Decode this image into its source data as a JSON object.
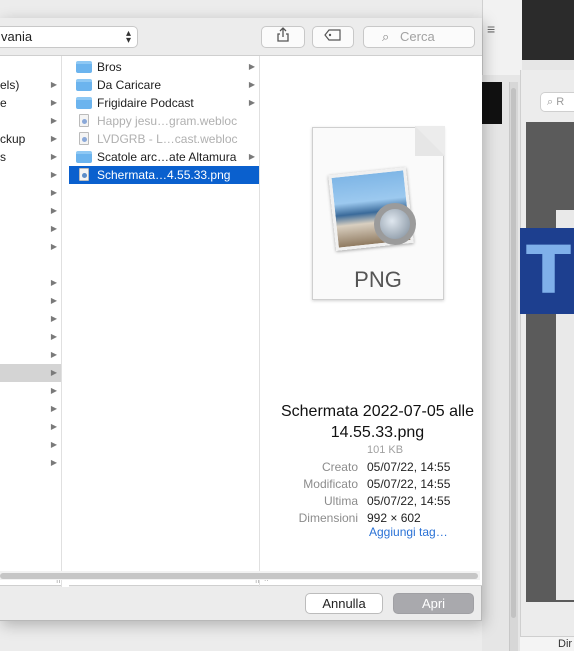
{
  "toolbar": {
    "path_value": "vania",
    "search_placeholder": "Cerca"
  },
  "sidebar_column": {
    "items": [
      {
        "label": "els)",
        "has_arrow": true,
        "selected": false
      },
      {
        "label": "e",
        "has_arrow": true,
        "selected": false
      },
      {
        "label": "",
        "has_arrow": true,
        "selected": false
      },
      {
        "label": "ckup",
        "has_arrow": true,
        "selected": false
      },
      {
        "label": "s",
        "has_arrow": true,
        "selected": false
      },
      {
        "label": "",
        "has_arrow": true,
        "selected": false
      },
      {
        "label": "",
        "has_arrow": true,
        "selected": false
      },
      {
        "label": "",
        "has_arrow": true,
        "selected": false
      },
      {
        "label": "",
        "has_arrow": true,
        "selected": false
      },
      {
        "label": "",
        "has_arrow": true,
        "selected": false
      },
      {
        "label": "",
        "has_arrow": true,
        "selected": false
      },
      {
        "label": "",
        "has_arrow": true,
        "selected": false
      },
      {
        "label": "",
        "has_arrow": true,
        "selected": false
      },
      {
        "label": "",
        "has_arrow": true,
        "selected": false
      },
      {
        "label": "",
        "has_arrow": true,
        "selected": false
      },
      {
        "label": "",
        "has_arrow": true,
        "selected": true
      },
      {
        "label": "",
        "has_arrow": true,
        "selected": false
      },
      {
        "label": "",
        "has_arrow": true,
        "selected": false
      },
      {
        "label": "",
        "has_arrow": true,
        "selected": false
      },
      {
        "label": "",
        "has_arrow": true,
        "selected": false
      },
      {
        "label": "",
        "has_arrow": true,
        "selected": false
      }
    ]
  },
  "files_column": {
    "items": [
      {
        "label": "Bros",
        "icon": "folder-icon",
        "has_arrow": true,
        "dim": false,
        "selected": false
      },
      {
        "label": "Da Caricare",
        "icon": "folder-icon",
        "has_arrow": true,
        "dim": false,
        "selected": false
      },
      {
        "label": "Frigidaire Podcast",
        "icon": "folder-icon",
        "has_arrow": true,
        "dim": false,
        "selected": false
      },
      {
        "label": "Happy jesu…gram.webloc",
        "icon": "webloc-file-icon",
        "has_arrow": false,
        "dim": true,
        "selected": false
      },
      {
        "label": "LVDGRB - L…cast.webloc",
        "icon": "webloc-file-icon",
        "has_arrow": false,
        "dim": true,
        "selected": false
      },
      {
        "label": "Scatole arc…ate Altamura",
        "icon": "folder-icon",
        "has_arrow": true,
        "dim": false,
        "selected": false
      },
      {
        "label": "Schermata…4.55.33.png",
        "icon": "png-file-icon",
        "has_arrow": false,
        "dim": false,
        "selected": true
      }
    ]
  },
  "preview": {
    "file_type_label": "PNG",
    "title": "Schermata 2022-07-05 alle 14.55.33.png",
    "size": "101 KB",
    "meta": [
      {
        "key": "Creato",
        "value": "05/07/22, 14:55"
      },
      {
        "key": "Modificato",
        "value": "05/07/22, 14:55"
      },
      {
        "key": "Ultima",
        "value": "05/07/22, 14:55"
      },
      {
        "key": "Dimensioni",
        "value": "992 × 602"
      }
    ],
    "add_tag": "Aggiungi tag…"
  },
  "footer": {
    "cancel_label": "Annulla",
    "open_label": "Apri"
  },
  "background": {
    "search_hint": "R",
    "big_letter": "T",
    "bottom_text": "Dir"
  },
  "colors": {
    "selection": "#0a60ce",
    "folder": "#6cb4ee",
    "link": "#2a72d6"
  }
}
